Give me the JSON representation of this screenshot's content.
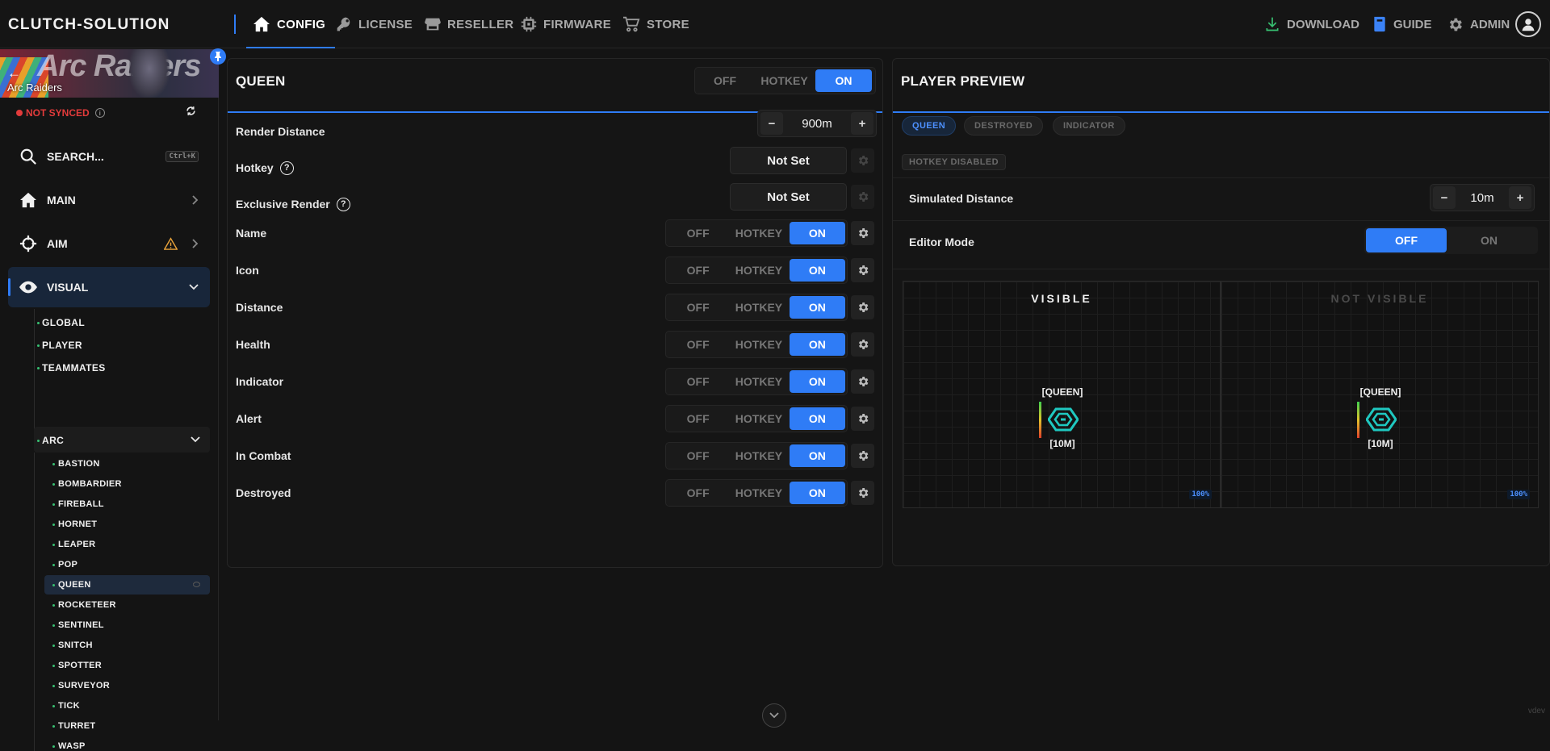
{
  "brand": "CLUTCH-SOLUTION",
  "nav": {
    "config": "CONFIG",
    "license": "LICENSE",
    "reseller": "RESELLER",
    "firmware": "FIRMWARE",
    "store": "STORE",
    "download": "DOWNLOAD",
    "guide": "GUIDE",
    "admin": "ADMIN"
  },
  "sidebar": {
    "game": "Arc Raiders",
    "banner_text": "Arc Raiders",
    "sync_status": "NOT SYNCED",
    "search": "SEARCH...",
    "search_shortcut": "Ctrl+K",
    "main": "MAIN",
    "aim": "AIM",
    "visual": "VISUAL",
    "visual_items": [
      "GLOBAL",
      "PLAYER",
      "TEAMMATES",
      "ARC"
    ],
    "arc_items": [
      "BASTION",
      "BOMBARDIER",
      "FIREBALL",
      "HORNET",
      "LEAPER",
      "POP",
      "QUEEN",
      "ROCKETEER",
      "SENTINEL",
      "SNITCH",
      "SPOTTER",
      "SURVEYOR",
      "TICK",
      "TURRET",
      "WASP"
    ]
  },
  "config": {
    "title": "QUEEN",
    "mode": {
      "off": "OFF",
      "hotkey": "HOTKEY",
      "on": "ON",
      "selected": "ON"
    },
    "render_distance_label": "Render Distance",
    "render_distance_value": "900m",
    "hotkey_label": "Hotkey",
    "hotkey_value": "Not Set",
    "exclusive_label": "Exclusive Render",
    "exclusive_value": "Not Set",
    "toggles": [
      {
        "label": "Name",
        "state": "ON"
      },
      {
        "label": "Icon",
        "state": "ON"
      },
      {
        "label": "Distance",
        "state": "ON"
      },
      {
        "label": "Health",
        "state": "ON"
      },
      {
        "label": "Indicator",
        "state": "ON"
      },
      {
        "label": "Alert",
        "state": "ON"
      },
      {
        "label": "In Combat",
        "state": "ON"
      },
      {
        "label": "Destroyed",
        "state": "ON"
      }
    ],
    "seg_off": "OFF",
    "seg_hotkey": "HOTKEY",
    "seg_on": "ON"
  },
  "preview": {
    "title": "PLAYER PREVIEW",
    "chips": [
      "QUEEN",
      "DESTROYED",
      "INDICATOR"
    ],
    "hotkey_status": "HOTKEY DISABLED",
    "simulated_label": "Simulated Distance",
    "simulated_value": "10m",
    "editor_label": "Editor Mode",
    "editor_off": "OFF",
    "editor_on": "ON",
    "visible": "VISIBLE",
    "not_visible": "NOT VISIBLE",
    "tag_name": "[QUEEN]",
    "tag_distance": "[10M]",
    "zoom": "100%"
  },
  "footer": {
    "version": "vdev"
  },
  "colors": {
    "accent": "#2f7cf6",
    "warning": "#e8a23a",
    "sync_error": "#e23b3b",
    "icon_teal": "#1fc8c0"
  }
}
